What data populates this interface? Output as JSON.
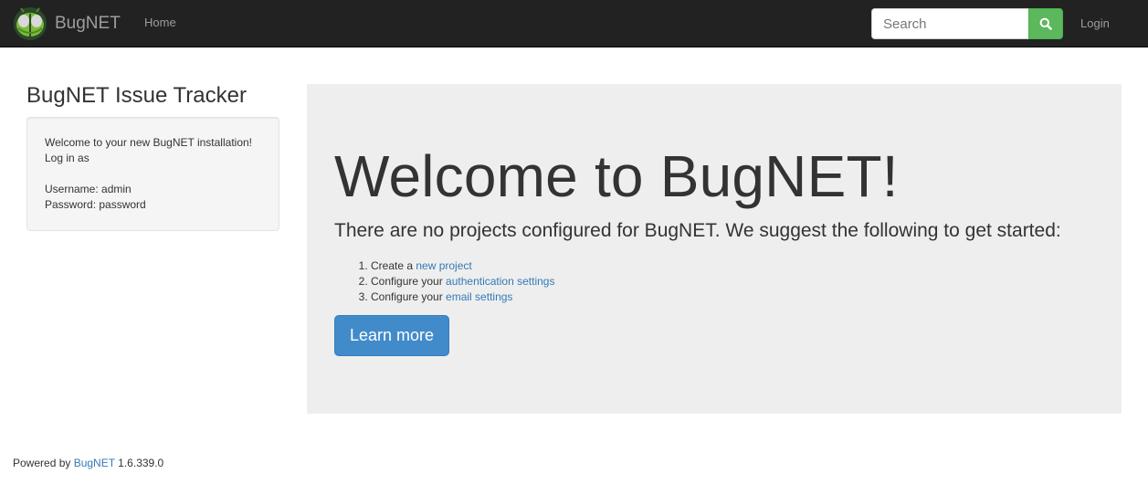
{
  "navbar": {
    "brand_name": "BugNET",
    "logo_icon": "bug-icon",
    "home_label": "Home",
    "search_placeholder": "Search",
    "search_icon": "search-icon",
    "login_label": "Login",
    "colors": {
      "background": "#222222",
      "link": "#9d9d9d",
      "search_button": "#5cb85c"
    }
  },
  "sidebar": {
    "title": "BugNET Issue Tracker",
    "welcome_line": "Welcome to your new BugNET installation!",
    "login_line": "Log in as",
    "username_line": "Username: admin",
    "password_line": "Password: password"
  },
  "main": {
    "heading": "Welcome to BugNET!",
    "lead": "There are no projects configured for BugNET. We suggest the following to get started:",
    "steps": [
      {
        "prefix": "Create a ",
        "link": "new project"
      },
      {
        "prefix": "Configure your ",
        "link": "authentication settings"
      },
      {
        "prefix": "Configure your ",
        "link": "email settings"
      }
    ],
    "button_label": "Learn more",
    "colors": {
      "background": "#eeeeee",
      "button": "#428bca",
      "link": "#337ab7"
    }
  },
  "footer": {
    "prefix": "Powered by ",
    "link": "BugNET",
    "version": " 1.6.339.0"
  }
}
